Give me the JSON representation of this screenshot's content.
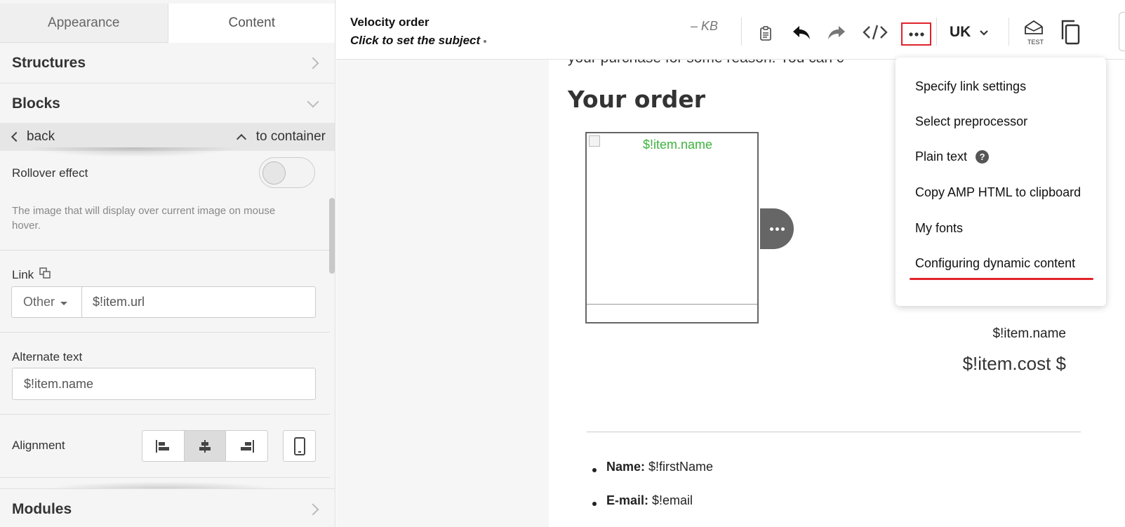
{
  "left_panel": {
    "tabs": [
      {
        "label": "Appearance"
      },
      {
        "label": "Content"
      }
    ],
    "structures_label": "Structures",
    "blocks_label": "Blocks",
    "back_label": "back",
    "to_container_label": "to container",
    "rollover_label": "Rollover effect",
    "rollover_on": false,
    "rollover_hint": "The image that will display over current image on mouse hover.",
    "link_label": "Link",
    "link_type": "Other",
    "link_value": "$!item.url",
    "alt_label": "Alternate text",
    "alt_value": "$!item.name",
    "alignment_label": "Alignment",
    "alignment_selected": "center",
    "modules_label": "Modules"
  },
  "toolbar": {
    "title": "Velocity order",
    "subject": "Click to set the subject",
    "size": "– KB",
    "language": "UK",
    "test_label": "TEST",
    "icons": [
      "notes-icon",
      "undo-icon",
      "redo-icon",
      "code-icon",
      "more-icon",
      "chevron-down-icon",
      "test-icon",
      "preview-icon"
    ]
  },
  "email": {
    "cut_text": "your purchase for some reason. You can c",
    "heading": "Your order",
    "image_alt": "$!item.name",
    "item_name": "$!item.name",
    "item_cost": "$!item.cost $",
    "list": [
      {
        "label": "Name:",
        "value": " $!firstName"
      },
      {
        "label": "E-mail:",
        "value": " $!email"
      }
    ]
  },
  "menu": {
    "items": [
      {
        "label": "Specify link settings"
      },
      {
        "label": "Select preprocessor"
      },
      {
        "label": "Plain text",
        "help": "?"
      },
      {
        "label": "Copy AMP HTML to clipboard"
      },
      {
        "label": "My fonts"
      },
      {
        "label": "Configuring dynamic content"
      }
    ]
  },
  "colors": {
    "highlight_red": "#e0242b",
    "alt_text_green": "#3cb33c"
  }
}
